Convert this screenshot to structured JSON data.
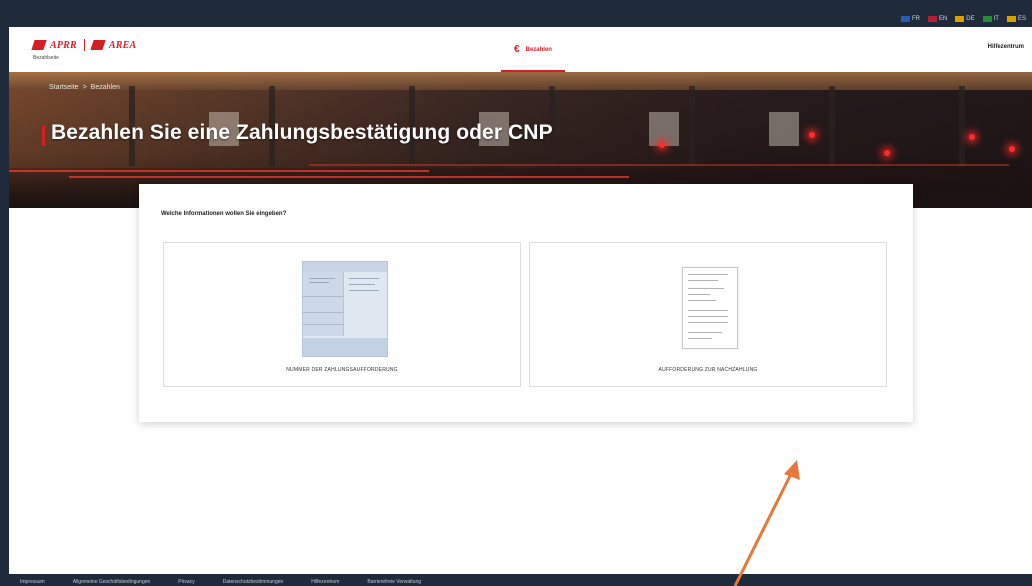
{
  "language_bar": [
    {
      "code": "FR",
      "color": "#2c5bb5"
    },
    {
      "code": "EN",
      "color": "#b22234"
    },
    {
      "code": "DE",
      "color": "#dda000"
    },
    {
      "code": "IT",
      "color": "#2a8a3c"
    },
    {
      "code": "ES",
      "color": "#d1a400"
    }
  ],
  "header": {
    "logo_brand_1": "APRR",
    "logo_brand_2": "AREA",
    "logo_sub": "Bezahlseite",
    "nav_pay": "Bezahlen",
    "help_center": "Hilfezentrum"
  },
  "hero": {
    "breadcrumb_home": "Startseite",
    "breadcrumb_sep": ">",
    "breadcrumb_current": "Bezahlen",
    "title": "Bezahlen Sie eine Zahlungsbestätigung oder CNP"
  },
  "card": {
    "question": "Welche Informationen wollen Sie eingeben?",
    "option_1": "NUMMER DER ZAHLUNGSAUFFORDERUNG",
    "option_2": "AUFFORDERUNG ZUR NACHZAHLUNG"
  },
  "footer": {
    "links": [
      "Impressum",
      "Allgemeine Geschäftsbedingungen",
      "Privacy",
      "Datenschutzbestimmungen",
      "Hilfezentrum",
      "Barrierefreie Verwaltung"
    ]
  },
  "colors": {
    "brand_red": "#d51f27",
    "frame_dark": "#1f2a3a",
    "annotation_arrow": "#e8773a"
  }
}
